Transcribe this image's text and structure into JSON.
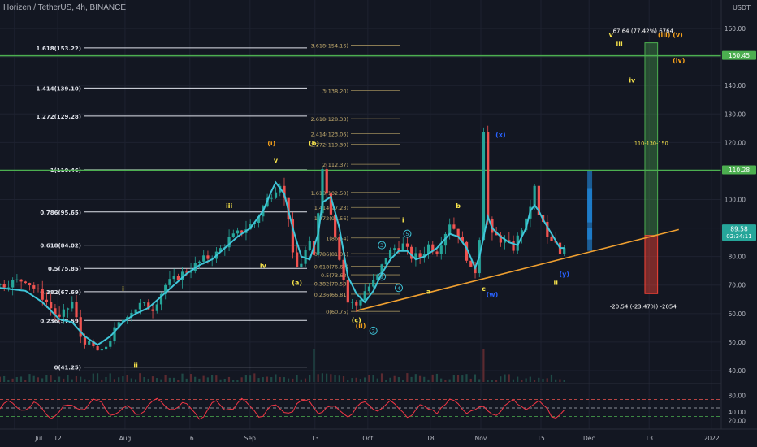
{
  "header": {
    "title": "Horizen / TetherUS, 4h, BINANCE",
    "currency": "USDT"
  },
  "chart_data": {
    "type": "candlestick",
    "ylim": [
      36,
      170
    ],
    "x_ticks": [
      "Jul",
      "12",
      "Aug",
      "16",
      "Sep",
      "13",
      "Oct",
      "18",
      "Nov",
      "15",
      "Dec",
      "13",
      "2022"
    ],
    "y_ticks": [
      "160.00",
      "150.00",
      "140.00",
      "130.00",
      "120.00",
      "110.00",
      "100.00",
      "90.00",
      "80.00",
      "70.00",
      "60.00",
      "50.00",
      "40.00"
    ],
    "price_labels": [
      {
        "text": "150.45",
        "value": 150.45,
        "color": "#4caf50"
      },
      {
        "text": "110.28",
        "value": 110.28,
        "color": "#4caf50"
      },
      {
        "text": "89.58",
        "sub": "02:34:11",
        "value": 89.58,
        "color": "#26a69a"
      }
    ],
    "close_series_anchors": [
      [
        0,
        70
      ],
      [
        6,
        72
      ],
      [
        10,
        66
      ],
      [
        14,
        58
      ],
      [
        17,
        64
      ],
      [
        19,
        52
      ],
      [
        21,
        49
      ],
      [
        24,
        46
      ],
      [
        27,
        54
      ],
      [
        30,
        60
      ],
      [
        33,
        63
      ],
      [
        36,
        62
      ],
      [
        39,
        70
      ],
      [
        42,
        73
      ],
      [
        45,
        76
      ],
      [
        48,
        79
      ],
      [
        51,
        81
      ],
      [
        54,
        86
      ],
      [
        57,
        89
      ],
      [
        60,
        92
      ],
      [
        63,
        100
      ],
      [
        66,
        106
      ],
      [
        68,
        94
      ],
      [
        69,
        80
      ],
      [
        70,
        76
      ],
      [
        71,
        78
      ],
      [
        72,
        82
      ],
      [
        73,
        84
      ],
      [
        74,
        80
      ],
      [
        76,
        112
      ],
      [
        77,
        102
      ],
      [
        78,
        96
      ],
      [
        79,
        88
      ],
      [
        80,
        80
      ],
      [
        81,
        72
      ],
      [
        82,
        64
      ],
      [
        84,
        63
      ],
      [
        86,
        68
      ],
      [
        88,
        71
      ],
      [
        89,
        73
      ],
      [
        91,
        80
      ],
      [
        93,
        83
      ],
      [
        95,
        84
      ],
      [
        97,
        80
      ],
      [
        99,
        80
      ],
      [
        101,
        84
      ],
      [
        103,
        82
      ],
      [
        106,
        92
      ],
      [
        108,
        88
      ],
      [
        110,
        80
      ],
      [
        111,
        75
      ],
      [
        112,
        75
      ],
      [
        113,
        87
      ],
      [
        114,
        125
      ],
      [
        115,
        93
      ],
      [
        116,
        87
      ],
      [
        117,
        87
      ],
      [
        119,
        85
      ],
      [
        121,
        83
      ],
      [
        123,
        90
      ],
      [
        124,
        92
      ],
      [
        125,
        98
      ],
      [
        126,
        104
      ],
      [
        127,
        94
      ],
      [
        128,
        92
      ],
      [
        129,
        86
      ],
      [
        131,
        84
      ],
      [
        132,
        81
      ],
      [
        133,
        84
      ]
    ],
    "ma_series_anchors": [
      [
        0,
        69
      ],
      [
        6,
        68
      ],
      [
        10,
        64
      ],
      [
        14,
        58
      ],
      [
        17,
        57
      ],
      [
        20,
        52
      ],
      [
        23,
        49
      ],
      [
        26,
        52
      ],
      [
        29,
        57
      ],
      [
        32,
        60
      ],
      [
        35,
        62
      ],
      [
        38,
        66
      ],
      [
        41,
        70
      ],
      [
        44,
        74
      ],
      [
        47,
        77
      ],
      [
        50,
        79
      ],
      [
        53,
        83
      ],
      [
        56,
        87
      ],
      [
        59,
        90
      ],
      [
        62,
        96
      ],
      [
        64,
        103
      ],
      [
        65,
        106
      ],
      [
        67,
        102
      ],
      [
        69,
        90
      ],
      [
        71,
        80
      ],
      [
        73,
        79
      ],
      [
        75,
        88
      ],
      [
        76,
        99
      ],
      [
        78,
        101
      ],
      [
        80,
        90
      ],
      [
        82,
        73
      ],
      [
        84,
        67
      ],
      [
        86,
        64
      ],
      [
        88,
        68
      ],
      [
        90,
        74
      ],
      [
        92,
        79
      ],
      [
        94,
        82
      ],
      [
        96,
        82
      ],
      [
        98,
        79
      ],
      [
        100,
        80
      ],
      [
        103,
        83
      ],
      [
        106,
        88
      ],
      [
        108,
        87
      ],
      [
        110,
        83
      ],
      [
        112,
        76
      ],
      [
        113,
        80
      ],
      [
        115,
        94
      ],
      [
        116,
        90
      ],
      [
        118,
        87
      ],
      [
        120,
        85
      ],
      [
        122,
        84
      ],
      [
        124,
        90
      ],
      [
        125,
        96
      ],
      [
        126,
        98
      ],
      [
        127,
        96
      ],
      [
        128,
        93
      ],
      [
        130,
        88
      ],
      [
        132,
        83
      ],
      [
        133,
        83
      ]
    ],
    "horizontal_lines": [
      {
        "value": 150.45
      },
      {
        "value": 110.28
      }
    ],
    "trendline": {
      "from": [
        84,
        61
      ],
      "to": [
        160,
        89.5
      ]
    },
    "fib_left": [
      {
        "text": "1.618(153.22)",
        "value": 153.22
      },
      {
        "text": "1.414(139.10)",
        "value": 139.1
      },
      {
        "text": "1.272(129.28)",
        "value": 129.28
      },
      {
        "text": "1(110.46)",
        "value": 110.46
      },
      {
        "text": "0.786(95.65)",
        "value": 95.65
      },
      {
        "text": "0.618(84.02)",
        "value": 84.02
      },
      {
        "text": "0.5(75.85)",
        "value": 75.85
      },
      {
        "text": "0.382(67.69)",
        "value": 67.69
      },
      {
        "text": "0.236(57.59)",
        "value": 57.59
      },
      {
        "text": "0(41.25)",
        "value": 41.25
      }
    ],
    "fib_right": [
      {
        "text": "3.618(154.16)",
        "value": 154.16
      },
      {
        "text": "3(138.20)",
        "value": 138.2
      },
      {
        "text": "2.618(128.33)",
        "value": 128.33
      },
      {
        "text": "2.414(123.06)",
        "value": 123.06
      },
      {
        "text": "2.272(119.39)",
        "value": 119.39
      },
      {
        "text": "2(112.37)",
        "value": 112.37
      },
      {
        "text": "1.618(102.50)",
        "value": 102.5
      },
      {
        "text": "1.414(97.23)",
        "value": 97.23
      },
      {
        "text": "1.272(93.56)",
        "value": 93.56
      },
      {
        "text": "1(86.54)",
        "value": 86.54
      },
      {
        "text": "0.786(81.01)",
        "value": 81.01
      },
      {
        "text": "0.618(76.67)",
        "value": 76.67
      },
      {
        "text": "0.5(73.62)",
        "value": 73.62
      },
      {
        "text": "0.382(70.58)",
        "value": 70.58
      },
      {
        "text": "0.236(66.81)",
        "value": 66.81
      },
      {
        "text": "0(60.75)",
        "value": 60.75
      }
    ],
    "wave_labels": [
      {
        "text": "(i)",
        "color": "#f7a21b",
        "x": 64,
        "y": 119
      },
      {
        "text": "(b)",
        "color": "#f7e34b",
        "x": 74,
        "y": 119
      },
      {
        "text": "v",
        "color": "#f7e34b",
        "x": 65,
        "y": 113
      },
      {
        "text": "iii",
        "color": "#f7e34b",
        "x": 54,
        "y": 97
      },
      {
        "text": "iv",
        "color": "#f7e34b",
        "x": 62,
        "y": 76
      },
      {
        "text": "(a)",
        "color": "#f7e34b",
        "x": 70,
        "y": 70
      },
      {
        "text": "i",
        "color": "#f7e34b",
        "x": 29,
        "y": 68
      },
      {
        "text": "ii",
        "color": "#f7e34b",
        "x": 32,
        "y": 41
      },
      {
        "text": "(c)",
        "color": "#f7e34b",
        "x": 84,
        "y": 57
      },
      {
        "text": "(ii)",
        "color": "#f7a21b",
        "x": 85,
        "y": 55
      },
      {
        "text": "i",
        "color": "#f7e34b",
        "x": 95,
        "y": 92
      },
      {
        "text": "a",
        "color": "#f7e34b",
        "x": 101,
        "y": 67
      },
      {
        "text": "b",
        "color": "#f7e34b",
        "x": 108,
        "y": 97
      },
      {
        "text": "c",
        "color": "#f7e34b",
        "x": 114,
        "y": 68
      },
      {
        "text": "(w)",
        "color": "#2962ff",
        "x": 116,
        "y": 66
      },
      {
        "text": "(x)",
        "color": "#2962ff",
        "x": 118,
        "y": 122
      },
      {
        "text": "(y)",
        "color": "#2962ff",
        "x": 133,
        "y": 73
      },
      {
        "text": "ii",
        "color": "#f7e34b",
        "x": 131,
        "y": 70
      },
      {
        "text": "iii",
        "color": "#f7e34b",
        "x": 146,
        "y": 154
      },
      {
        "text": "iv",
        "color": "#f7e34b",
        "x": 149,
        "y": 141
      },
      {
        "text": "v",
        "color": "#f7e34b",
        "x": 144,
        "y": 157
      },
      {
        "text": "(iii) (v)",
        "color": "#f7a21b",
        "x": 158,
        "y": 157
      },
      {
        "text": "(iv)",
        "color": "#f7a21b",
        "x": 160,
        "y": 148
      }
    ],
    "circle_labels": [
      {
        "text": "1",
        "x": 90,
        "y": 73
      },
      {
        "text": "2",
        "x": 88,
        "y": 54
      },
      {
        "text": "3",
        "x": 90,
        "y": 84
      },
      {
        "text": "4",
        "x": 94,
        "y": 69
      },
      {
        "text": "5",
        "x": 96,
        "y": 88
      }
    ],
    "measure_box": {
      "top_text": "67.64 (77.42%) 6764",
      "bottom_text": "-20.54 (-23.47%) -2054",
      "mid_text": "110-130-150",
      "top": 155,
      "entry": 87.4,
      "bottom": 67
    },
    "rsi": {
      "ylim": [
        0,
        100
      ],
      "ticks": [
        "80.00",
        "40.00",
        "20.00"
      ],
      "levels": [
        70,
        50,
        30
      ]
    }
  }
}
